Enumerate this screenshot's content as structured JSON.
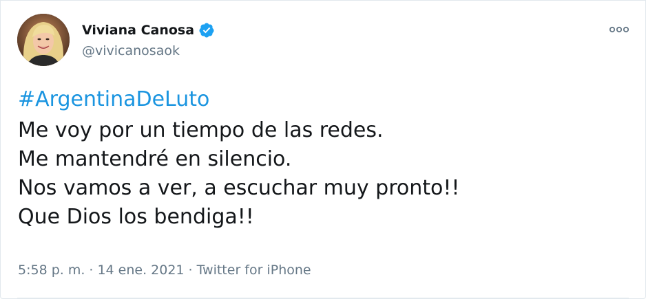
{
  "author": {
    "display_name": "Viviana Canosa",
    "handle": "@vivicanosaok",
    "verified": true,
    "avatar_icon": "profile-photo"
  },
  "tweet": {
    "hashtag": "#ArgentinaDeLuto",
    "lines": [
      "Me voy por un tiempo de las redes.",
      "Me mantendré en silencio.",
      "Nos vamos a ver, a escuchar muy pronto!!",
      "Que Dios los bendiga!!"
    ]
  },
  "meta": {
    "time": "5:58 p. m.",
    "separator": "·",
    "date": "14 ene. 2021",
    "source": "Twitter for iPhone"
  },
  "colors": {
    "link": "#1b95e0",
    "verified_badge": "#1da1f2",
    "text_primary": "#14171a",
    "text_secondary": "#657786"
  }
}
